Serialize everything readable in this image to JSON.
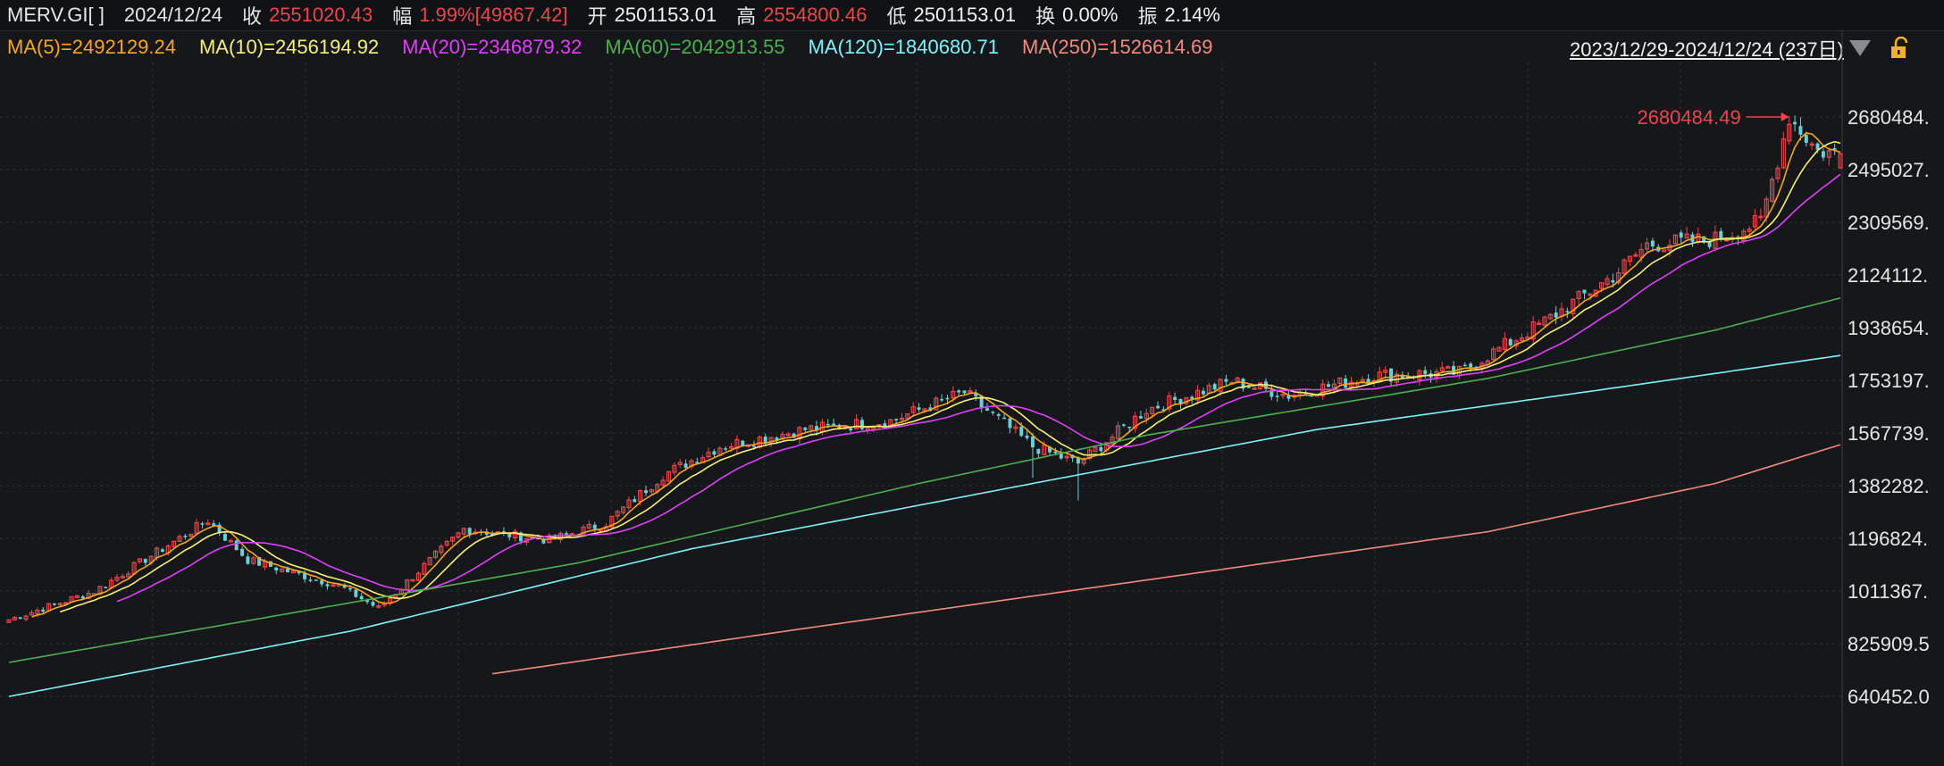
{
  "header": {
    "symbol": "MERV.GI[ ]",
    "date": "2024/12/24",
    "close_label": "收",
    "close_value": "2551020.43",
    "change_label": "幅",
    "change_value": "1.99%[49867.42]",
    "open_label": "开",
    "open_value": "2501153.01",
    "high_label": "高",
    "high_value": "2554800.46",
    "low_label": "低",
    "low_value": "2501153.01",
    "turnover_label": "换",
    "turnover_value": "0.00%",
    "amplitude_label": "振",
    "amplitude_value": "2.14%"
  },
  "ma_legend": [
    {
      "text": "MA(5)=2492129.24",
      "color": "#f5a623"
    },
    {
      "text": "MA(10)=2456194.92",
      "color": "#f4ef7a"
    },
    {
      "text": "MA(20)=2346879.32",
      "color": "#e040fb"
    },
    {
      "text": "MA(60)=2042913.55",
      "color": "#4caf50"
    },
    {
      "text": "MA(120)=1840680.71",
      "color": "#7ff3f7"
    },
    {
      "text": "MA(250)=1526614.69",
      "color": "#f48a7e"
    }
  ],
  "range_label": "2023/12/29-2024/12/24 (237日)",
  "icons": {
    "dropdown": "triangle-down-icon",
    "lock": "lock-icon"
  },
  "colors": {
    "up": "#e8474c",
    "down": "#6ad0d6",
    "background": "#16171b",
    "grid": "#2e3036"
  },
  "chart_data": {
    "type": "candlestick",
    "y_tick_labels": [
      "2680484.",
      "2495027.",
      "2309569.",
      "2124112.",
      "1938654.",
      "1753197.",
      "1567739.",
      "1382282.",
      "1196824.",
      "1011367.",
      "825909.5",
      "640452.0"
    ],
    "y_ticks": [
      2680484,
      2495027,
      2309569,
      2124112,
      1938654,
      1753197,
      1567739,
      1382282,
      1196824,
      1011367,
      825909.5,
      640452.0
    ],
    "max_annotation": {
      "label": "2680484.49",
      "value": 2680484.49
    },
    "n_bars": 237,
    "close_anchors": [
      [
        0,
        910000
      ],
      [
        15,
        1010000
      ],
      [
        35,
        1260000
      ],
      [
        42,
        1120000
      ],
      [
        58,
        1030000
      ],
      [
        65,
        950000
      ],
      [
        80,
        1230000
      ],
      [
        95,
        1190000
      ],
      [
        105,
        1250000
      ],
      [
        115,
        1420000
      ],
      [
        125,
        1520000
      ],
      [
        140,
        1580000
      ],
      [
        155,
        1610000
      ],
      [
        168,
        1710000
      ],
      [
        180,
        1520000
      ],
      [
        188,
        1460000
      ],
      [
        200,
        1650000
      ],
      [
        215,
        1750000
      ],
      [
        225,
        1700000
      ],
      [
        240,
        1770000
      ],
      [
        255,
        1780000
      ],
      [
        270,
        1960000
      ],
      [
        282,
        2120000
      ],
      [
        288,
        2230000
      ],
      [
        294,
        2240000
      ],
      [
        300,
        2250000
      ],
      [
        308,
        2310000
      ],
      [
        313,
        2680000
      ],
      [
        318,
        2560000
      ],
      [
        322,
        2551020
      ]
    ],
    "ma_lines": [
      {
        "name": "MA(5)",
        "period": 5
      },
      {
        "name": "MA(10)",
        "period": 10
      },
      {
        "name": "MA(20)",
        "period": 20
      },
      {
        "name": "MA(60)",
        "anchors": [
          [
            0,
            760000
          ],
          [
            40,
            900000
          ],
          [
            100,
            1110000
          ],
          [
            160,
            1390000
          ],
          [
            200,
            1560000
          ],
          [
            260,
            1760000
          ],
          [
            300,
            1930000
          ],
          [
            322,
            2043000
          ]
        ]
      },
      {
        "name": "MA(120)",
        "anchors": [
          [
            0,
            640000
          ],
          [
            60,
            870000
          ],
          [
            120,
            1160000
          ],
          [
            180,
            1390000
          ],
          [
            230,
            1580000
          ],
          [
            280,
            1720000
          ],
          [
            322,
            1840681
          ]
        ]
      },
      {
        "name": "MA(250)",
        "anchors": [
          [
            85,
            720000
          ],
          [
            140,
            880000
          ],
          [
            200,
            1050000
          ],
          [
            260,
            1220000
          ],
          [
            300,
            1390000
          ],
          [
            322,
            1526615
          ]
        ]
      }
    ]
  }
}
